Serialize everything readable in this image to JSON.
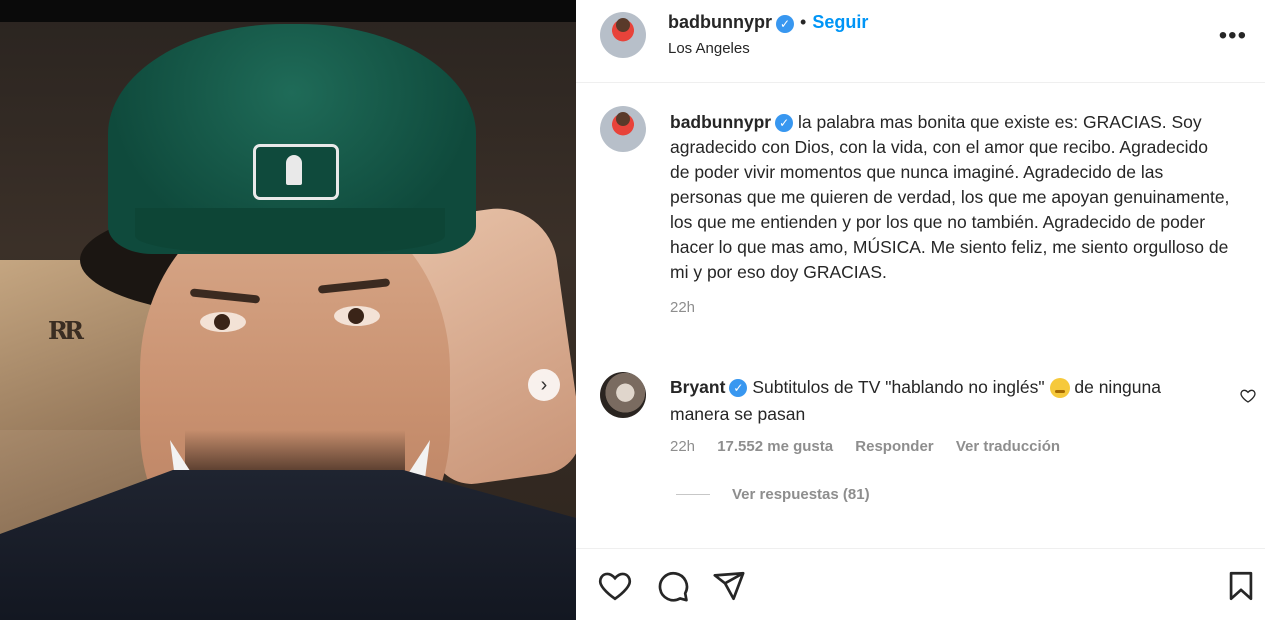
{
  "post": {
    "header": {
      "username": "badbunnypr",
      "verified_mark": "✓",
      "separator": "•",
      "follow_label": "Seguir",
      "location": "Los Angeles",
      "more_label": "•••"
    },
    "caption": {
      "username": "badbunnypr",
      "verified_mark": "✓",
      "text": "la palabra mas bonita que existe es: GRACIAS. Soy agradecido con Dios, con la vida, con el amor que recibo. Agradecido de poder vivir momentos que nunca imaginé. Agradecido de las personas que me quieren de verdad, los que me apoyan genuinamente, los que me entienden y por los que no también. Agradecido de poder hacer lo que mas amo, MÚSICA. Me siento feliz, me siento orgulloso de mi y por eso doy GRACIAS.",
      "time": "22h"
    },
    "comment": {
      "username": "Bryant",
      "verified_mark": "✓",
      "text_before_emoji": "Subtitulos de TV \"hablando no inglés\"",
      "text_after_emoji": "de ninguna manera se pasan",
      "time": "22h",
      "likes": "17.552 me gusta",
      "reply_label": "Responder",
      "translate_label": "Ver traducción",
      "view_replies_label": "Ver respuestas (81)"
    },
    "media": {
      "logo_text": "RR",
      "next_arrow": "›"
    },
    "icons": {
      "like": "heart-icon",
      "comment": "comment-icon",
      "share": "send-icon",
      "save": "bookmark-icon"
    },
    "colors": {
      "follow": "#0095f6",
      "verified": "#3897f0",
      "muted": "#8e8e8e"
    }
  }
}
